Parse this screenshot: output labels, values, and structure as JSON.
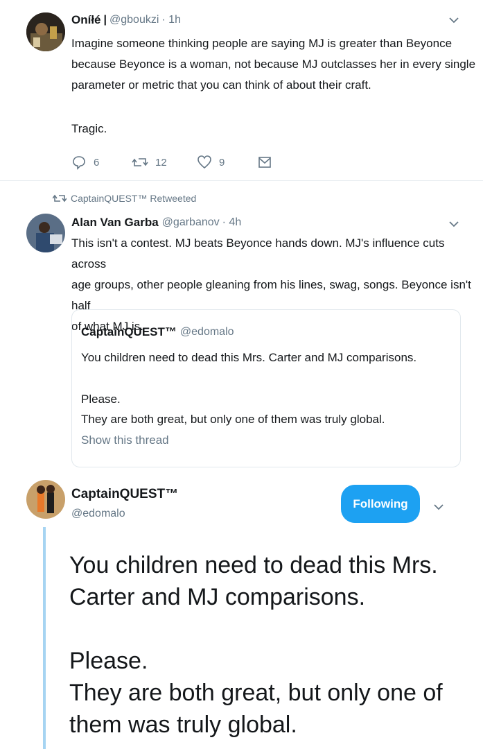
{
  "tweet1": {
    "name": "Oníłé",
    "separator": "|",
    "handle": "@gboukzi",
    "time": "· 1h",
    "lines": [
      "Imagine someone thinking people are saying MJ is greater than Beyonce",
      "because Beyonce is a woman, not because MJ outclasses her in every single",
      "parameter or metric that you can think of about their craft."
    ],
    "line4": "Tragic.",
    "replies": "6",
    "retweets": "12",
    "likes": "9"
  },
  "retweet_banner": {
    "text": "CaptainQUEST™ Retweeted"
  },
  "tweet2": {
    "name": "Alan Van Garba",
    "handle": "@garbanov",
    "time": "· 4h",
    "lines": [
      "This isn't a contest. MJ beats Beyonce hands down. MJ's influence cuts across",
      "age groups, other people gleaning from his lines, swag, songs. Beyonce isn't half",
      "of what MJ is."
    ]
  },
  "quoted": {
    "name": "CaptainQUEST™",
    "handle": "@edomalo",
    "line1": "You children need to dead this Mrs. Carter and MJ comparisons.",
    "line2": "Please.",
    "line3": "They are both great, but only one of them was truly global.",
    "show_thread": "Show this thread"
  },
  "main_tweet": {
    "name": "CaptainQUEST™",
    "handle": "@edomalo",
    "follow_label": "Following",
    "lines": [
      "You children need to dead this Mrs.",
      "Carter and MJ comparisons.",
      "",
      "Please.",
      "They are both great, but only one of",
      "them was truly global."
    ]
  },
  "icons": {
    "reply": "reply-icon",
    "retweet": "retweet-icon",
    "like": "heart-icon",
    "dm": "envelope-icon",
    "caret": "chevron-down-icon"
  },
  "colors": {
    "accent": "#1da1f2",
    "muted": "#657786",
    "thread_line": "#a6d4f2"
  }
}
